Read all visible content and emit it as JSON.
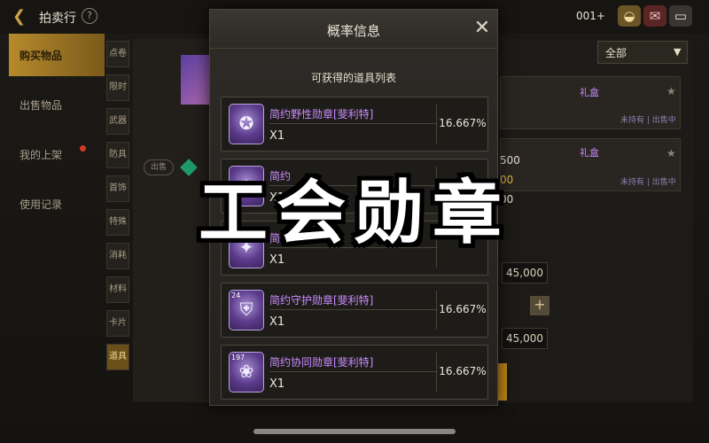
{
  "app": {
    "title": "拍卖行",
    "back_icon": "chevron-left-icon",
    "help_icon": "help-icon",
    "currency_text": "001+"
  },
  "top_icons": [
    "bag-icon",
    "mail-icon",
    "chat-icon"
  ],
  "sidebar": {
    "items": [
      {
        "label": "购买物品",
        "active": true
      },
      {
        "label": "出售物品"
      },
      {
        "label": "我的上架",
        "badge": true
      },
      {
        "label": "使用记录"
      }
    ]
  },
  "categories": [
    "点卷",
    "限时",
    "武器",
    "防具",
    "首饰",
    "特殊",
    "消耗",
    "材料",
    "卡片",
    "道具"
  ],
  "left_panel": {
    "sell_label": "出售"
  },
  "right_panel": {
    "filter": "全部",
    "cards": [
      {
        "title": "礼盒",
        "sub": "未持有 | 出售中"
      },
      {
        "title": "礼盒",
        "sub": "未持有 | 出售中"
      }
    ],
    "numbers": [
      "500",
      "00",
      "00"
    ],
    "prices": [
      "45,000",
      "45,000"
    ],
    "plus_label": "+"
  },
  "modal": {
    "title": "概率信息",
    "close_label": "✕",
    "subtitle": "可获得的道具列表",
    "items": [
      {
        "name": "简约野性勋章[斐利特]",
        "qty": "X1",
        "prob": "16.667%",
        "icon": "shield-medal-icon",
        "tag": ""
      },
      {
        "name": "简约",
        "qty": "X1",
        "prob": "",
        "icon": "medal-icon",
        "tag": ""
      },
      {
        "name": "简",
        "qty": "X1",
        "prob": "",
        "icon": "medal-icon",
        "tag": ""
      },
      {
        "name": "简约守护勋章[斐利特]",
        "qty": "X1",
        "prob": "16.667%",
        "icon": "guard-medal-icon",
        "tag": "24"
      },
      {
        "name": "简约协同勋章[斐利特]",
        "qty": "X1",
        "prob": "16.667%",
        "icon": "coop-medal-icon",
        "tag": "197"
      }
    ]
  },
  "overlay": {
    "caption": "工会勋章"
  }
}
